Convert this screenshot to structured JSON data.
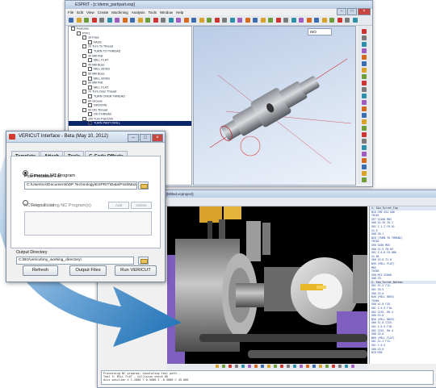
{
  "esprit_window": {
    "title": "ESPRIT - [c:\\demo_part\\part.esp]",
    "menus": [
      "File",
      "Edit",
      "View",
      "Create",
      "Machining",
      "Analysis",
      "Tools",
      "Window",
      "Help"
    ],
    "tree_items": [
      "Features",
      "PTF1",
      "10 Face",
      "FACE",
      "20 Turn To Thread",
      "TURN TO THREAD",
      "30 Mill Flat",
      "MILL FLAT",
      "40 Mill Boss",
      "MILL BOSS",
      "50 Mill Boss",
      "MILL BOSS",
      "60 Mill Flat",
      "MILL FLAT",
      "70 Turn Over Thread",
      "TURN OVER THREAD",
      "80 Groove",
      "GROOVE",
      "90 OD Thread",
      "OD THREAD",
      "100 Turn Part Drill",
      "TURN PART DRILL"
    ],
    "view_dropdown": "ISO"
  },
  "sim_window": {
    "title": "VERICUT - Operations: Operation 1 [Milled.vcproject]",
    "code_lines": [
      "N10 G90 G54 G00",
      "T0101",
      "G97 S1200 M03",
      "G00 X2.45 Z0.1",
      "G01 Z-1.2 F0.01",
      "X2.6",
      "G00 Z0.1",
      "N20 (TURN TO THREAD)",
      "T0202",
      "G96 S450 M03",
      "G00 X1.9 Z0.05",
      "G01 Z-0.8 F0.008",
      "X2.05",
      "G00 X3.0 Z1.0",
      "N30 (MILL FLAT)",
      "M05",
      "T0303",
      "G98 M13 S2000",
      "G00 C0.",
      "G01 X1.2 F12.",
      "G01 Y0.5",
      "G00 X3.0",
      "N40 (MILL BOSS)",
      "T0404",
      "G00 X1.8 C45.",
      "G01 Z-0.5 F10.",
      "G02 C135. R0.4",
      "G00 X3.0",
      "N50 (MILL BOSS)",
      "G00 X1.8 C225.",
      "G01 Z-0.5 F10.",
      "G02 C315. R0.4",
      "G00 X3.0",
      "N60 (MILL FLAT)",
      "G01 X1.2 F12.",
      "G01 Y-0.5",
      "G00 X3.0",
      "N70 M30"
    ],
    "code_headers": [
      "1. Sim_Turret_Top",
      "2. Sim_Turret_Bottom"
    ],
    "status_lines": [
      "Processing NC program: simulating tool path...",
      "Tool 3: MILL FLAT  -  Collision check OK",
      "Axis position X 1.2000 Y 0.5000 Z -0.5000 C 45.000"
    ]
  },
  "vericut_dialog": {
    "title": "VERICUT Interface - Beta (May 10, 2012)",
    "tabs": [
      "Template",
      "Attach",
      "Tools",
      "G-Code Offsets",
      "NC Programs"
    ],
    "active_tab": "NC Programs",
    "generate_nc_label": "Generate NC Program",
    "post_processor_label": "Post Processor File",
    "post_processor_path": "C:\\Users\\cs\\Documents\\DP Technology\\ESPRIT\\Data\\Post\\Mazak\\...",
    "select_existing_label": "Select Existing NC Program(s)",
    "add_label": "Add",
    "delete_label": "Delete",
    "nc_program_list_label": "NC Program List",
    "output_directory_label": "Output Directory",
    "output_directory_path": "C:\\BG\\vericut\\my_working_directory\\",
    "buttons": [
      "Refresh",
      "Output Files",
      "Run VERICUT"
    ]
  },
  "colors": {
    "arrow_blue": "#1a6fb5",
    "selection": "#0a246a",
    "title_gradient_top": "#dbe6f4"
  }
}
